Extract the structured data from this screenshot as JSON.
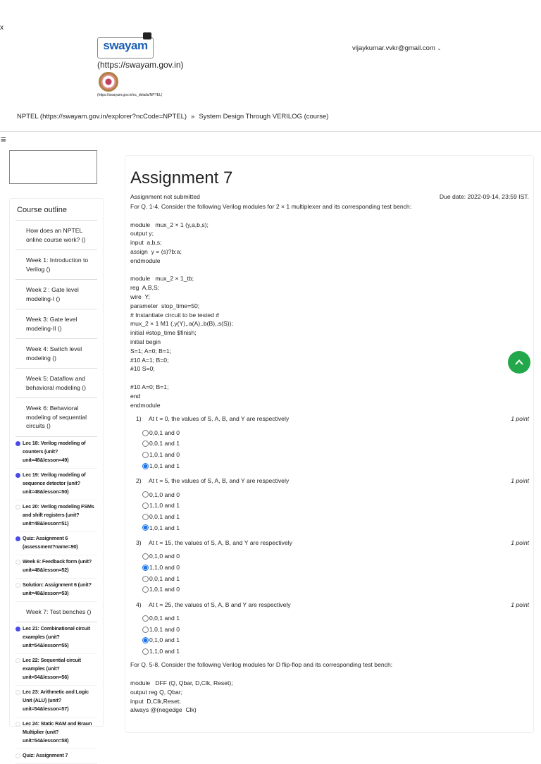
{
  "header": {
    "close": "x",
    "logo_text": "swayam",
    "swayam_link": "(https://swayam.gov.in)",
    "nptel_link": "(https://swayam.gov.in/nc_details/NPTEL)",
    "user": "vijaykumar.vvkr@gmail.com"
  },
  "breadcrumb": {
    "item1": "NPTEL (https://swayam.gov.in/explorer?ncCode=NPTEL)",
    "sep": "»",
    "item2": "System Design Through VERILOG (course)"
  },
  "sidebar": {
    "title": "Course outline",
    "items": [
      {
        "type": "week",
        "label": "How does an NPTEL online course work? ()"
      },
      {
        "type": "week",
        "label": "Week 1: Introduction to Verilog ()"
      },
      {
        "type": "week",
        "label": "Week 2 : Gate level modeling-I ()"
      },
      {
        "type": "week",
        "label": "Week 3: Gate level modeling-II ()"
      },
      {
        "type": "week",
        "label": "Week 4: Switch level modeling ()"
      },
      {
        "type": "week",
        "label": "Week 5: Dataflow and behavioral modeling ()"
      },
      {
        "type": "week",
        "label": "Week 6: Behavioral modeling of sequential circuits ()"
      },
      {
        "type": "lesson",
        "done": true,
        "label": "Lec 18: Verilog modeling of counters (unit?unit=48&lesson=49)"
      },
      {
        "type": "lesson",
        "done": true,
        "label": "Lec 19: Verilog modeling of sequence detector (unit?unit=48&lesson=50)"
      },
      {
        "type": "lesson",
        "done": false,
        "label": "Lec 20: Verilog modeling FSMs and shift registers (unit?unit=48&lesson=51)"
      },
      {
        "type": "lesson",
        "done": true,
        "label": "Quiz: Assignment 6 (assessment?name=90)"
      },
      {
        "type": "lesson",
        "done": false,
        "label": "Week 6: Feedback form (unit?unit=48&lesson=52)"
      },
      {
        "type": "lesson",
        "done": false,
        "label": "Solution: Assignment 6 (unit?unit=48&lesson=53)"
      },
      {
        "type": "week",
        "label": "Week 7: Test benches ()"
      },
      {
        "type": "lesson",
        "done": true,
        "label": "Lec 21: Combinational circuit examples (unit?unit=54&lesson=55)"
      },
      {
        "type": "lesson",
        "done": false,
        "label": "Lec 22: Sequential circuit examples (unit?unit=54&lesson=56)"
      },
      {
        "type": "lesson",
        "done": false,
        "label": "Lec 23: Arithmetic and Logic Unit (ALU) (unit?unit=54&lesson=57)"
      },
      {
        "type": "lesson",
        "done": false,
        "label": "Lec 24: Static RAM and Braun Multiplier (unit?unit=54&lesson=58)"
      },
      {
        "type": "lesson",
        "done": false,
        "label": "Quiz: Assignment 7"
      }
    ]
  },
  "main": {
    "title": "Assignment 7",
    "status": "Assignment not submitted",
    "due": "Due date: 2022-09-14, 23:59 IST.",
    "intro1": "For Q. 1-4. Consider the following Verilog modules for 2 × 1 multiplexer and its corresponding test bench:",
    "code1": [
      "module   mux_2 × 1 (y,a,b,s);",
      "output y;",
      "input  a,b,s;",
      "assign  y = (s)?b:a;",
      "endmodule",
      "",
      "module   mux_2 × 1_tb;",
      "reg  A,B,S;",
      "wire  Y;",
      "parameter  stop_time=50;",
      "# Instantiate circuit to be tested #",
      "mux_2 × 1 M1 (.y(Y),.a(A),.b(B),.s(S));",
      "initial #stop_time $finish;",
      "initial begin",
      "S=1; A=0; B=1;",
      "#10 A=1; B=0;",
      "#10 S=0;",
      "",
      "#10 A=0; B=1;",
      "end",
      "endmodule"
    ],
    "questions": [
      {
        "num": "1)",
        "text": "At t = 0, the values of S, A, B, and Y are respectively",
        "points": "1 point",
        "options": [
          "0,0,1 and 0",
          "0,0,1 and 1",
          "1,0,1 and 0",
          "1,0,1 and 1"
        ],
        "selected": 3
      },
      {
        "num": "2)",
        "text": "At t = 5, the values of S, A, B, and Y are respectively",
        "points": "1 point",
        "options": [
          "0,1,0 and 0",
          "1,1,0 and 1",
          "0,0,1 and 1",
          "1,0,1 and 1"
        ],
        "selected": 3
      },
      {
        "num": "3)",
        "text": "At t = 15, the values of S, A, B, and Y are respectively",
        "points": "1 point",
        "options": [
          "0,1,0 and 0",
          "1,1,0 and 0",
          "0,0,1 and 1",
          "1,0,1 and 0"
        ],
        "selected": 1
      },
      {
        "num": "4)",
        "text": "At t = 25, the values of S, A, B and Y are respectively",
        "points": "1 point",
        "options": [
          "0,0,1 and 1",
          "1,0,1 and 0",
          "0,1,0 and 1",
          "1,1,0 and 1"
        ],
        "selected": 2
      }
    ],
    "intro2": "For Q. 5-8. Consider the following Verilog modules for D flip-flop and its corresponding test bench:",
    "code2": [
      "module   DFF (Q, Qbar, D,Clk, Reset);",
      "output reg Q, Qbar;",
      "input  D,Clk,Reset;",
      "always @(negedge  Clk)"
    ]
  },
  "colors": {
    "accent": "#22a84a",
    "radio": "#1a73e8",
    "done_dot": "#4a4ae8"
  }
}
